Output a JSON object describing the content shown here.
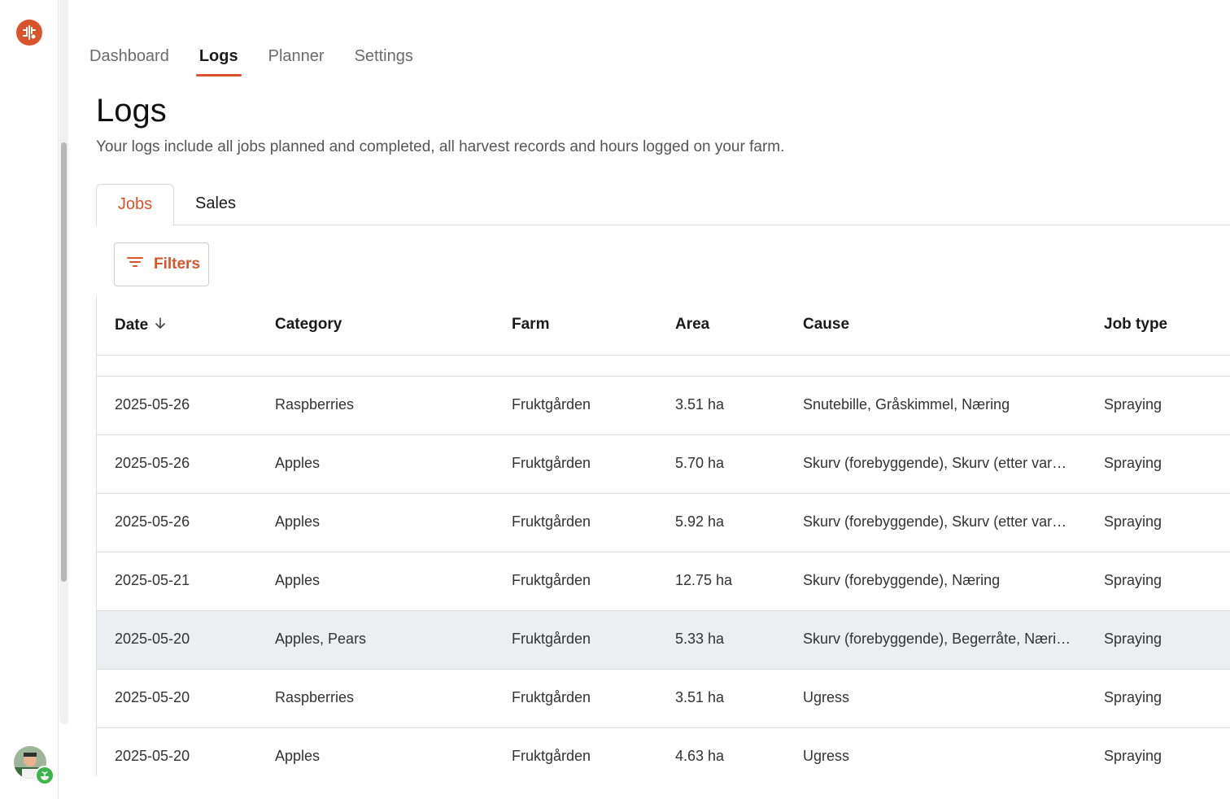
{
  "nav": {
    "items": [
      {
        "label": "Dashboard",
        "active": false
      },
      {
        "label": "Logs",
        "active": true
      },
      {
        "label": "Planner",
        "active": false
      },
      {
        "label": "Settings",
        "active": false
      }
    ]
  },
  "page": {
    "title": "Logs",
    "subtitle": "Your logs include all jobs planned and completed, all harvest records and hours logged on your farm."
  },
  "tabs": {
    "jobs": "Jobs",
    "sales": "Sales"
  },
  "toolbar": {
    "filters_label": "Filters"
  },
  "table": {
    "columns": {
      "date": "Date",
      "category": "Category",
      "farm": "Farm",
      "area": "Area",
      "cause": "Cause",
      "job_type": "Job type"
    },
    "rows": [
      {
        "date": "2025-05-26",
        "category": "Raspberries",
        "farm": "Fruktgården",
        "area": "3.51 ha",
        "cause": "Snutebille, Gråskimmel, Næring",
        "job_type": "Spraying"
      },
      {
        "date": "2025-05-26",
        "category": "Apples",
        "farm": "Fruktgården",
        "area": "5.70 ha",
        "cause": "Skurv (forebyggende), Skurv (etter vars...",
        "job_type": "Spraying"
      },
      {
        "date": "2025-05-26",
        "category": "Apples",
        "farm": "Fruktgården",
        "area": "5.92 ha",
        "cause": "Skurv (forebyggende), Skurv (etter vars...",
        "job_type": "Spraying"
      },
      {
        "date": "2025-05-21",
        "category": "Apples",
        "farm": "Fruktgården",
        "area": "12.75 ha",
        "cause": "Skurv (forebyggende), Næring",
        "job_type": "Spraying"
      },
      {
        "date": "2025-05-20",
        "category": "Apples, Pears",
        "farm": "Fruktgården",
        "area": "5.33 ha",
        "cause": "Skurv (forebyggende), Begerråte, Næring",
        "job_type": "Spraying"
      },
      {
        "date": "2025-05-20",
        "category": "Raspberries",
        "farm": "Fruktgården",
        "area": "3.51 ha",
        "cause": "Ugress",
        "job_type": "Spraying"
      },
      {
        "date": "2025-05-20",
        "category": "Apples",
        "farm": "Fruktgården",
        "area": "4.63 ha",
        "cause": "Ugress",
        "job_type": "Spraying"
      }
    ]
  },
  "colors": {
    "accent": "#d9532b",
    "row_highlight": "#eceef1",
    "badge_green": "#3cb54a"
  },
  "icons": {
    "logo": "tractor-logo-icon",
    "sort": "arrow-down-icon",
    "filter": "filter-lines-icon",
    "badge": "sprout-icon"
  }
}
